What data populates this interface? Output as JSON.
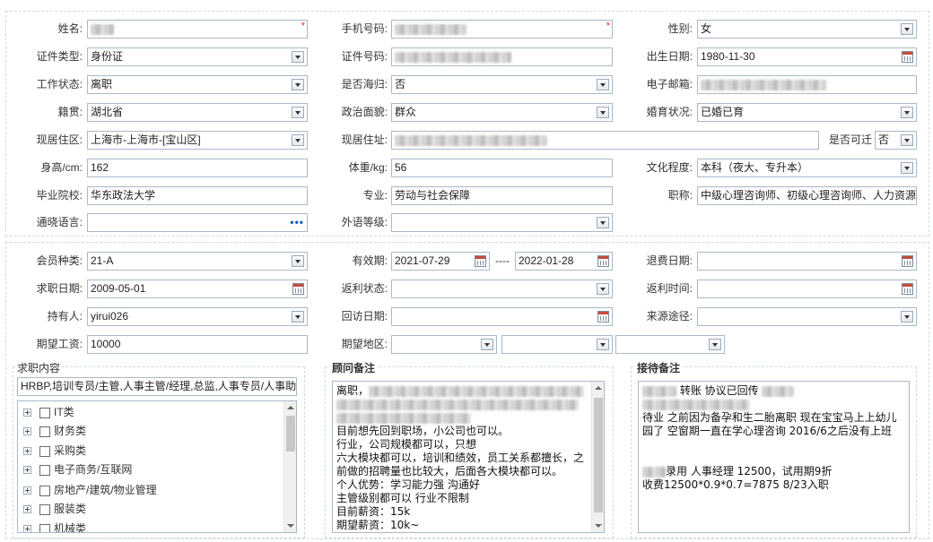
{
  "basic": {
    "name_label": "姓名:",
    "phone_label": "手机号码:",
    "gender_label": "性别:",
    "gender_value": "女",
    "idtype_label": "证件类型:",
    "idtype_value": "身份证",
    "idnum_label": "证件号码:",
    "birth_label": "出生日期:",
    "birth_value": "1980-11-30",
    "workstatus_label": "工作状态:",
    "workstatus_value": "离职",
    "returnee_label": "是否海归:",
    "returnee_value": "否",
    "email_label": "电子邮箱:",
    "native_label": "籍贯:",
    "native_value": "湖北省",
    "political_label": "政治面貌:",
    "political_value": "群众",
    "marital_label": "婚育状况:",
    "marital_value": "已婚已育",
    "region_label": "现居住区:",
    "region_value": "上海市-上海市-[宝山区]",
    "address_label": "现居住址:",
    "relocate_label": "是否可迁",
    "relocate_value": "否",
    "height_label": "身高/cm:",
    "height_value": "162",
    "weight_label": "体重/kg:",
    "weight_value": "56",
    "education_label": "文化程度:",
    "education_value": "本科（夜大、专升本）",
    "school_label": "毕业院校:",
    "school_value": "华东政法大学",
    "major_label": "专业:",
    "major_value": "劳动与社会保障",
    "title_label": "职称:",
    "title_value": "中级心理咨询师、初级心理咨询师、人力资源",
    "language_label": "通晓语言:",
    "language_dots": "•••",
    "fl_level_label": "外语等级:"
  },
  "member": {
    "type_label": "会员种类:",
    "type_value": "21-A",
    "valid_label": "有效期:",
    "valid_from": "2021-07-29",
    "valid_sep": "----",
    "valid_to": "2022-01-28",
    "refund_date_label": "退费日期:",
    "jobseek_date_label": "求职日期:",
    "jobseek_date_value": "2009-05-01",
    "rebate_status_label": "返利状态:",
    "rebate_time_label": "返利时间:",
    "holder_label": "持有人:",
    "holder_value": "yirui026",
    "visit_date_label": "回访日期:",
    "source_label": "来源途径:",
    "salary_label": "期望工资:",
    "salary_value": "10000",
    "area_label": "期望地区:"
  },
  "job": {
    "section_title": "求职内容",
    "summary": "HRBP,培训专员/主管,人事主管/经理,总监,人事专员/人事助",
    "categories": [
      "IT类",
      "财务类",
      "采购类",
      "电子商务/互联网",
      "房地产/建筑/物业管理",
      "服装类",
      "机械类"
    ]
  },
  "consultant": {
    "section_title": "顾问备注",
    "lines": [
      "离职，",
      "",
      "",
      "目前想先回到职场，小公司也可以。",
      "行业，公司规模都可以，只想",
      "六大模块都可以，培训和绩效，员工关系都擅长，之",
      "前做的招聘量也比较大，后面各大模块都可以。",
      "个人优势：学习能力强 沟通好",
      "主管级别都可以 行业不限制",
      "目前薪资：15k",
      "期望薪资：10k~"
    ]
  },
  "reception": {
    "section_title": "接待备注",
    "line1_text": "转账 协议已回传",
    "line3": "待业 之前因为备孕和生二胎离职 现在宝宝马上上幼儿",
    "line4": "园了 空窗期一直在学心理咨询 2016/6之后没有上班",
    "line5_text": "录用 人事经理  12500，试用期9折",
    "line6": "收费12500*0.9*0.7=7875  8/23入职"
  }
}
